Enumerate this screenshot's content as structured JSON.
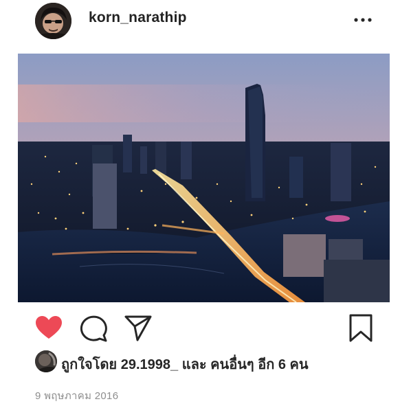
{
  "post": {
    "username": "korn_narathip",
    "more_icon": "more-horizontal-icon",
    "likes": {
      "prefix": "ถูกใจโดย",
      "liker": "29.1998_",
      "connector": "และ",
      "others": "คนอื่นๆ อีก 6 คน"
    },
    "date": "9 พฤษภาคม 2016",
    "liked": true
  },
  "colors": {
    "heart": "#ed4956",
    "text": "#262626",
    "muted": "#8e8e8e"
  }
}
